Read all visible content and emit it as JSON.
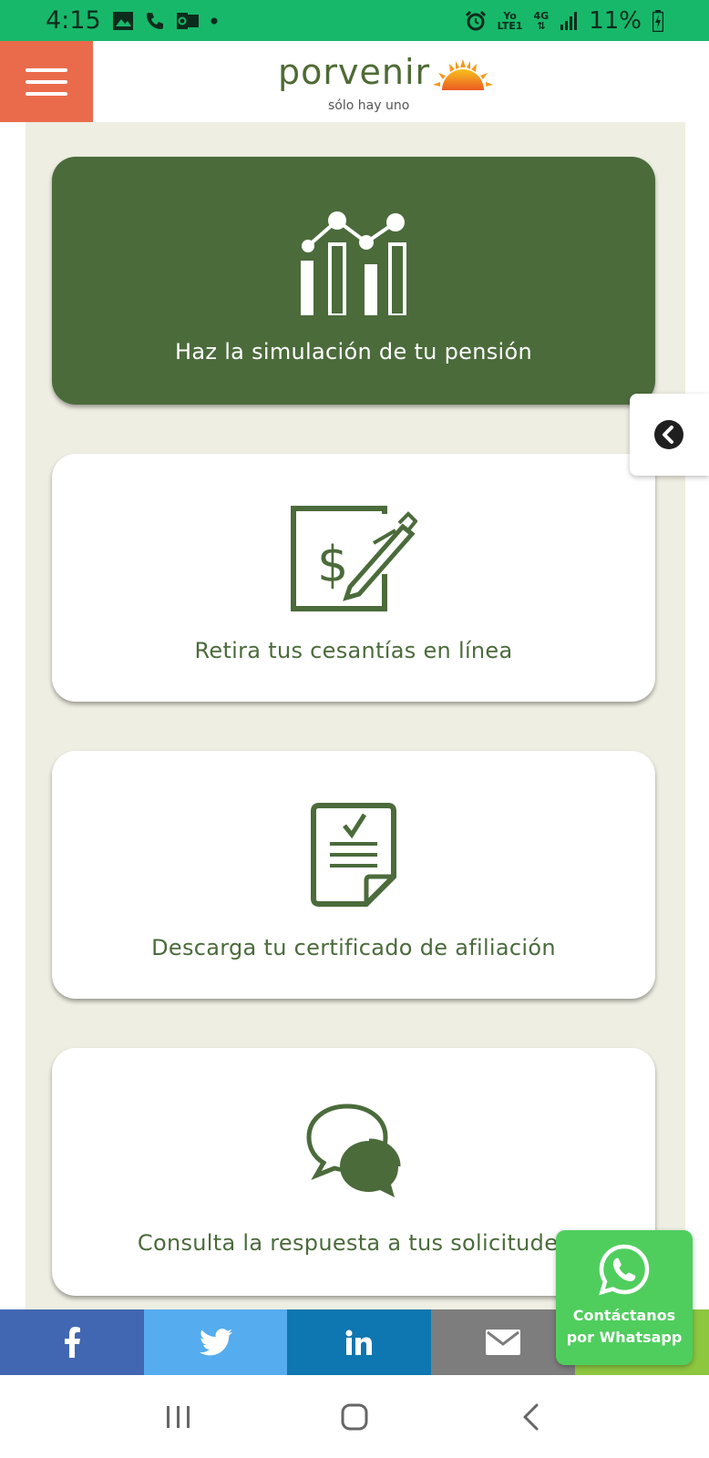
{
  "status_bar": {
    "time": "4:15",
    "carrier_top": "Yo",
    "carrier_bottom": "LTE1",
    "network": "4G",
    "battery": "11%"
  },
  "header": {
    "brand": "porvenir",
    "tagline": "sólo hay uno",
    "menu_icon": "hamburger-menu-icon",
    "colors": {
      "menu_bg": "#ea6b4c",
      "brand_green": "#4e6b34"
    }
  },
  "cards": [
    {
      "label": "Haz la simulación de tu pensión",
      "icon": "chart-icon"
    },
    {
      "label": "Retira tus cesantías en línea",
      "icon": "document-pen-icon"
    },
    {
      "label": "Descarga tu certificado de afiliación",
      "icon": "certificate-icon"
    },
    {
      "label": "Consulta la respuesta a tus solicitudes",
      "icon": "chat-bubbles-icon"
    }
  ],
  "side_tab": {
    "icon": "chevron-left-circle-icon"
  },
  "share_bar": [
    {
      "icon": "facebook-icon",
      "color": "#4267b2"
    },
    {
      "icon": "twitter-icon",
      "color": "#55acee"
    },
    {
      "icon": "linkedin-icon",
      "color": "#0e76b0"
    },
    {
      "icon": "email-icon",
      "color": "#7d7d7d"
    },
    {
      "icon": "share-icon",
      "color": "#8dc63f"
    }
  ],
  "whatsapp": {
    "line1": "Contáctanos",
    "line2": "por Whatsapp",
    "color": "#4fce5d"
  },
  "nav_bar": {
    "recents_icon": "recents-icon",
    "home_icon": "home-icon",
    "back_icon": "back-icon"
  },
  "colors": {
    "primary_card": "#4b6b3b",
    "content_bg": "#eeeee2"
  }
}
